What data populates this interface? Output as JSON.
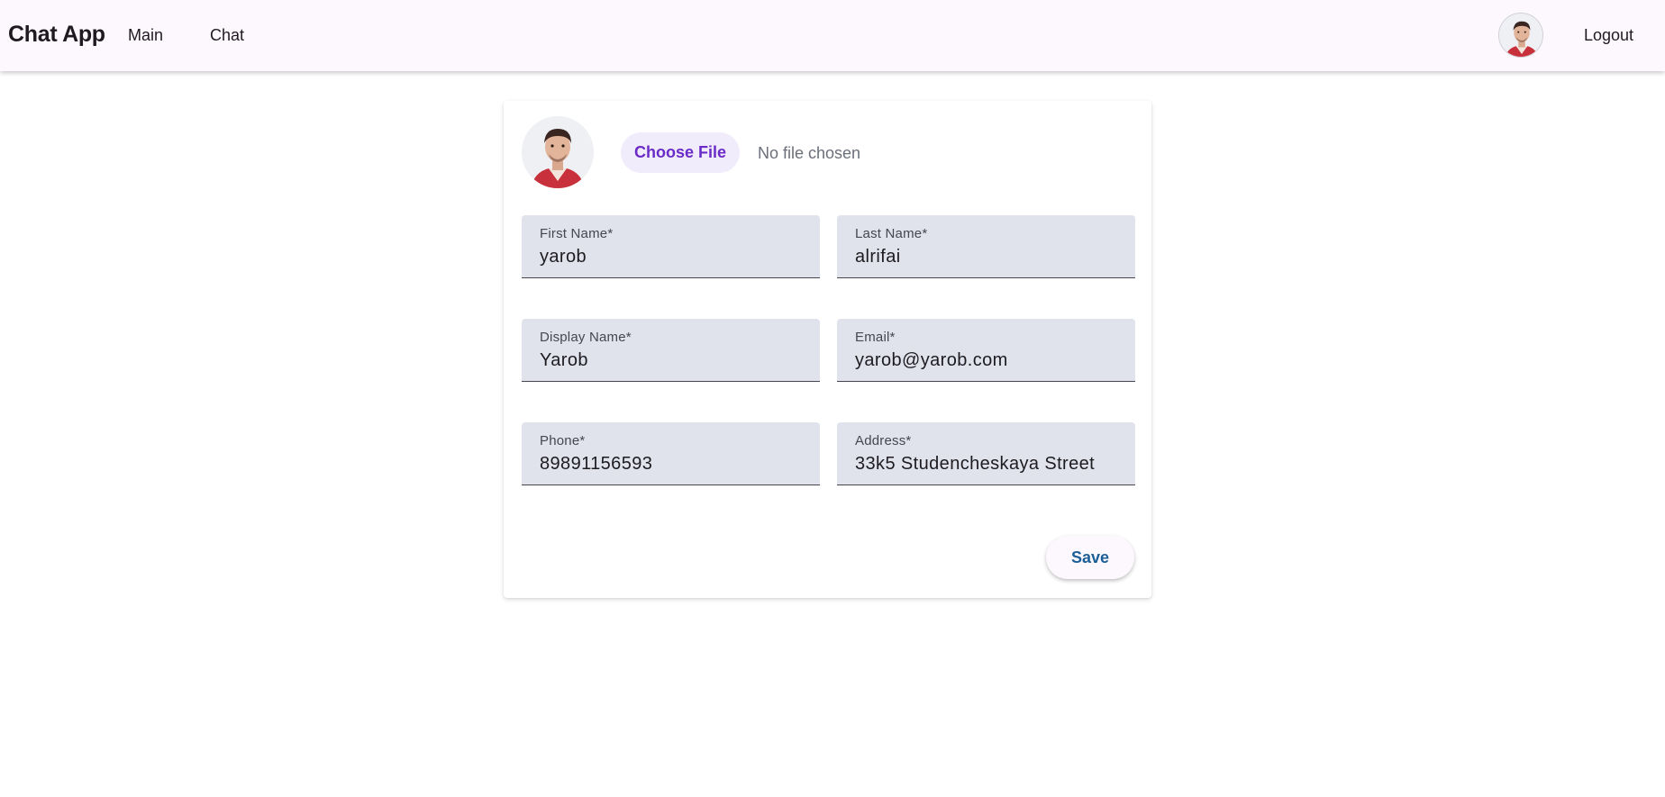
{
  "app": {
    "brand": "Chat App"
  },
  "nav": {
    "items": [
      {
        "label": "Main"
      },
      {
        "label": "Chat"
      }
    ],
    "logout_label": "Logout",
    "avatar_icon": "user-avatar-photo"
  },
  "profile": {
    "avatar_icon": "user-avatar-photo",
    "file_picker": {
      "button_label": "Choose File",
      "status": "No file chosen"
    },
    "fields": [
      {
        "label": "First Name*",
        "value": "yarob"
      },
      {
        "label": "Last Name*",
        "value": "alrifai"
      },
      {
        "label": "Display Name*",
        "value": "Yarob"
      },
      {
        "label": "Email*",
        "value": "yarob@yarob.com"
      },
      {
        "label": "Phone*",
        "value": "89891156593"
      },
      {
        "label": "Address*",
        "value": "33k5 Studencheskaya Street"
      }
    ],
    "save_label": "Save"
  },
  "colors": {
    "topbar_bg": "#fdf8fe",
    "field_bg": "#e0e3ec",
    "file_button_bg": "#f1ecfb",
    "file_button_text": "#6a2bc8",
    "save_text": "#1c5f96"
  }
}
